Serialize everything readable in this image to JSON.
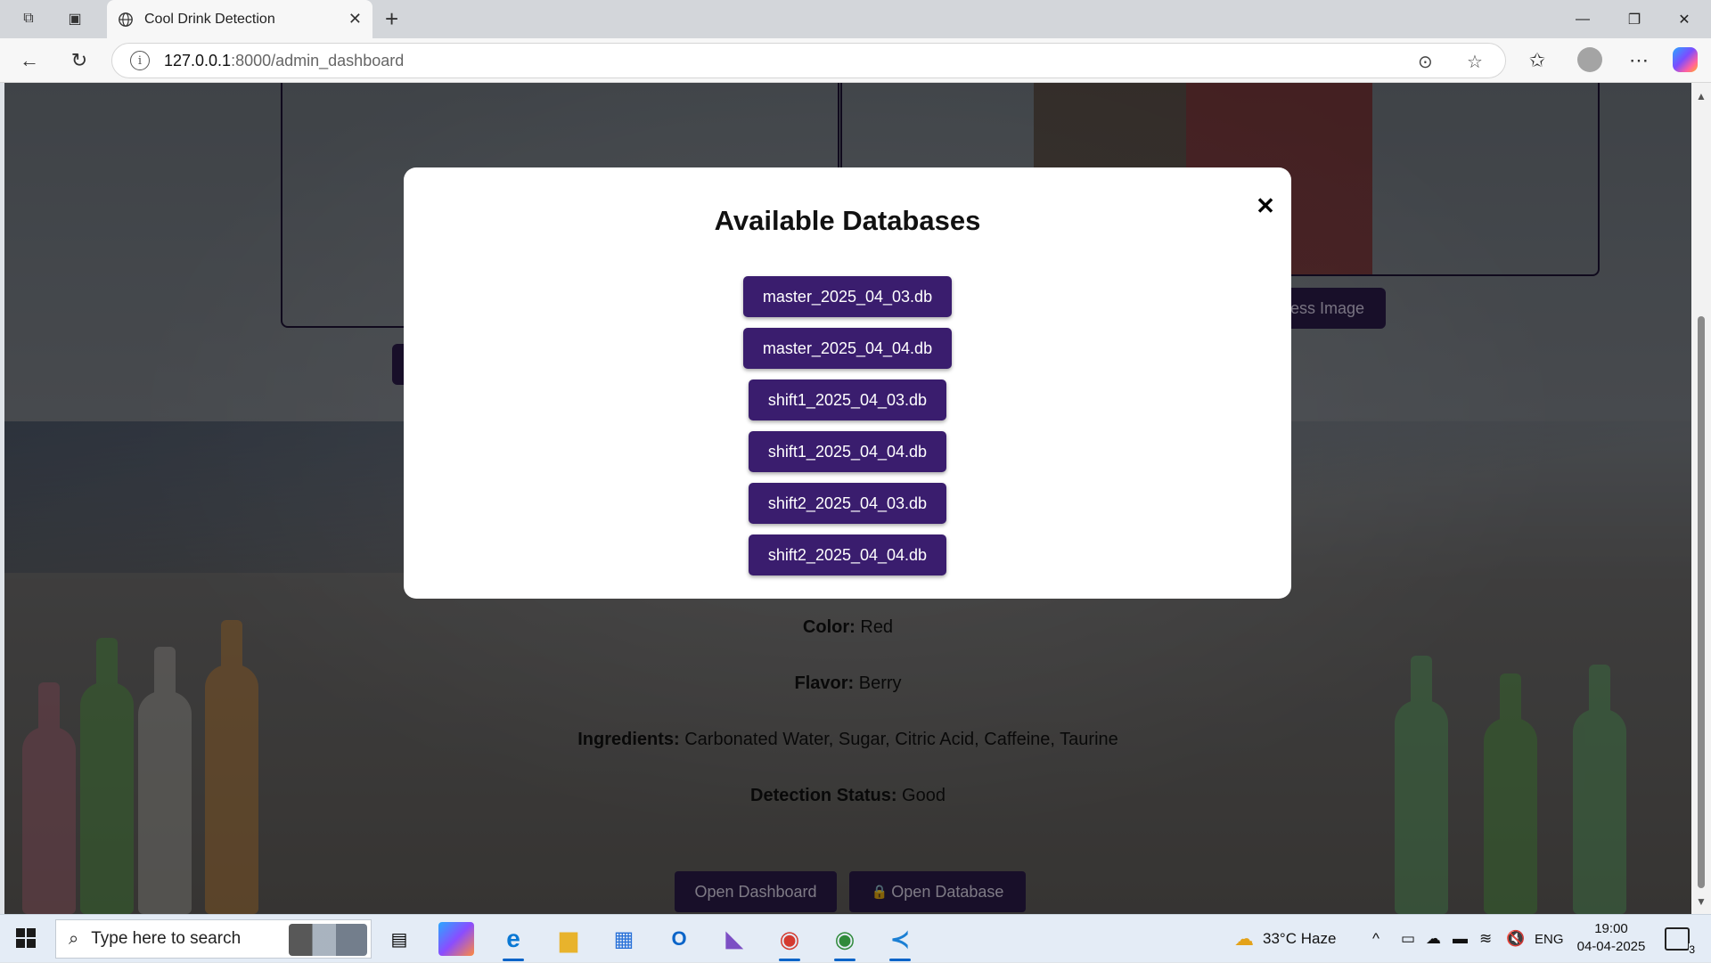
{
  "browser": {
    "tab_title": "Cool Drink Detection",
    "url_host": "127.0.0.1",
    "url_path": ":8000/admin_dashboard"
  },
  "page": {
    "ghost_process_label": "cess Image",
    "detail": {
      "color_label": "Color:",
      "color_value": " Red",
      "flavor_label": "Flavor:",
      "flavor_value": " Berry",
      "ingredients_label": "Ingredients:",
      "ingredients_value": " Carbonated Water, Sugar, Citric Acid, Caffeine, Taurine",
      "status_label": "Detection Status:",
      "status_value": " Good"
    },
    "open_dashboard_label": "Open Dashboard",
    "open_database_label": "Open Database",
    "lock_icon": "🔒"
  },
  "modal": {
    "title": "Available Databases",
    "close_glyph": "✕",
    "databases": [
      "master_2025_04_03.db",
      "master_2025_04_04.db",
      "shift1_2025_04_03.db",
      "shift1_2025_04_04.db",
      "shift2_2025_04_03.db",
      "shift2_2025_04_04.db"
    ]
  },
  "taskbar": {
    "search_placeholder": "Type here to search",
    "weather": "33°C  Haze",
    "language": "ENG",
    "time": "19:00",
    "date": "04-04-2025",
    "notification_count": "3"
  },
  "colors": {
    "modal_button": "#3a1d6e",
    "page_button": "#2a1b48"
  }
}
